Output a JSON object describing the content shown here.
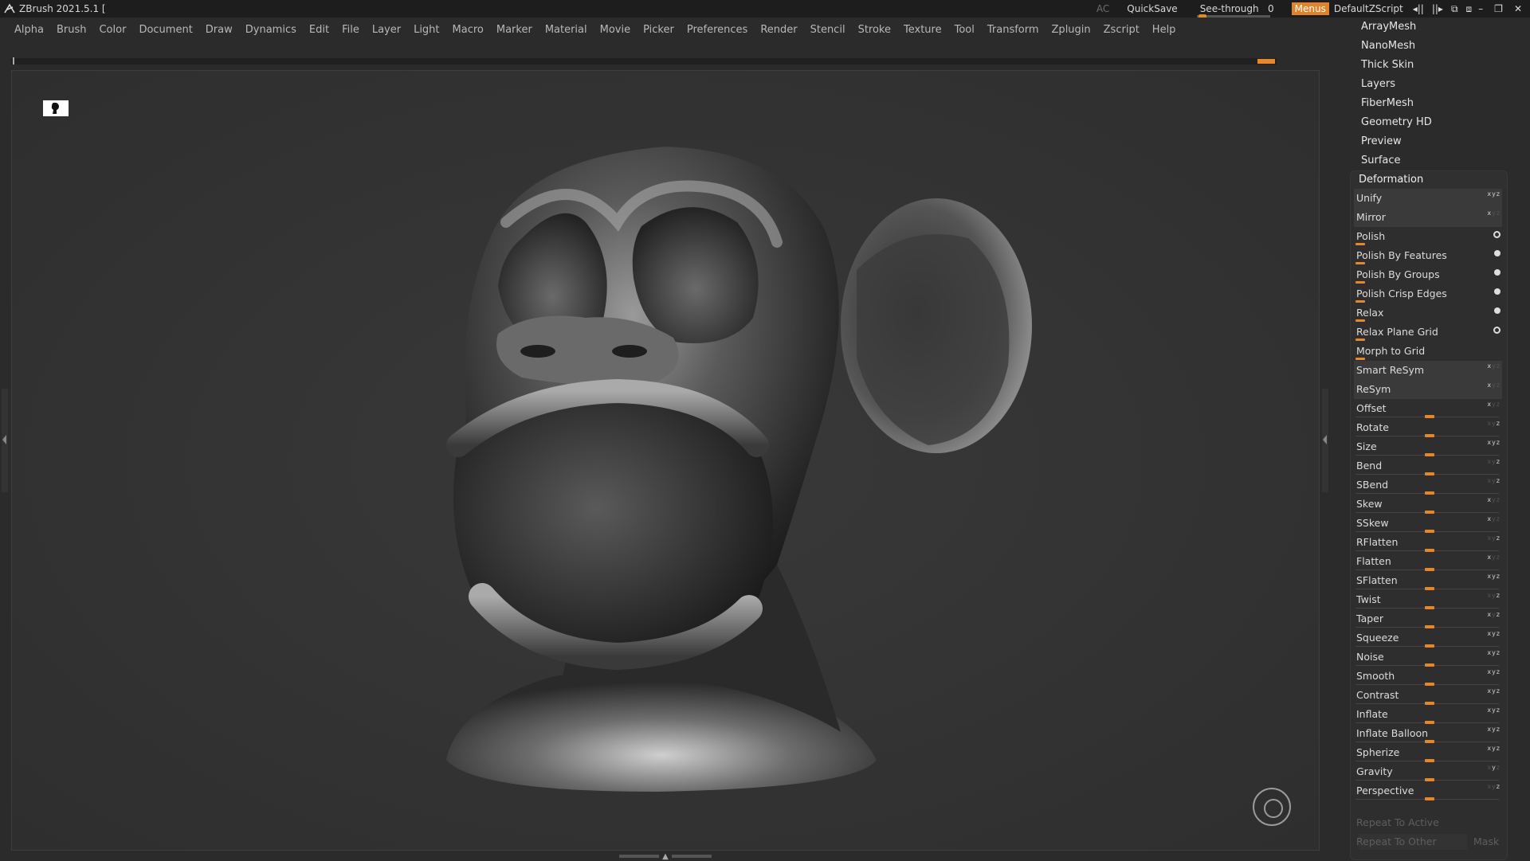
{
  "title": "ZBrush 2021.5.1 [",
  "topbar": {
    "ac": "AC",
    "quicksave": "QuickSave",
    "see_through_label": "See-through",
    "see_through_value": "0",
    "menus": "Menus",
    "script": "DefaultZScript"
  },
  "menu": [
    "Alpha",
    "Brush",
    "Color",
    "Document",
    "Draw",
    "Dynamics",
    "Edit",
    "File",
    "Layer",
    "Light",
    "Macro",
    "Marker",
    "Material",
    "Movie",
    "Picker",
    "Preferences",
    "Render",
    "Stencil",
    "Stroke",
    "Texture",
    "Tool",
    "Transform",
    "Zplugin",
    "Zscript",
    "Help"
  ],
  "subtools": [
    "ArrayMesh",
    "NanoMesh",
    "Thick Skin",
    "Layers",
    "FiberMesh",
    "Geometry HD",
    "Preview",
    "Surface"
  ],
  "deformation": {
    "header": "Deformation",
    "buttons": [
      "Unify",
      "Mirror"
    ],
    "polish": [
      "Polish",
      "Polish By Features",
      "Polish By Groups",
      "Polish Crisp Edges",
      "Relax",
      "Relax Plane Grid",
      "Morph to Grid"
    ],
    "resym": [
      "Smart ReSym",
      "ReSym"
    ],
    "sliders": [
      "Offset",
      "Rotate",
      "Size",
      "Bend",
      "SBend",
      "Skew",
      "SSkew",
      "RFlatten",
      "Flatten",
      "SFlatten",
      "Twist",
      "Taper",
      "Squeeze",
      "Noise",
      "Smooth",
      "Contrast",
      "Inflate",
      "Inflate Balloon",
      "Spherize",
      "Gravity",
      "Perspective"
    ],
    "repeat_active": "Repeat To Active",
    "repeat_other": "Repeat To Other",
    "mask": "Mask"
  },
  "colors": {
    "accent": "#e8862a",
    "bg": "#2b2b2b"
  }
}
